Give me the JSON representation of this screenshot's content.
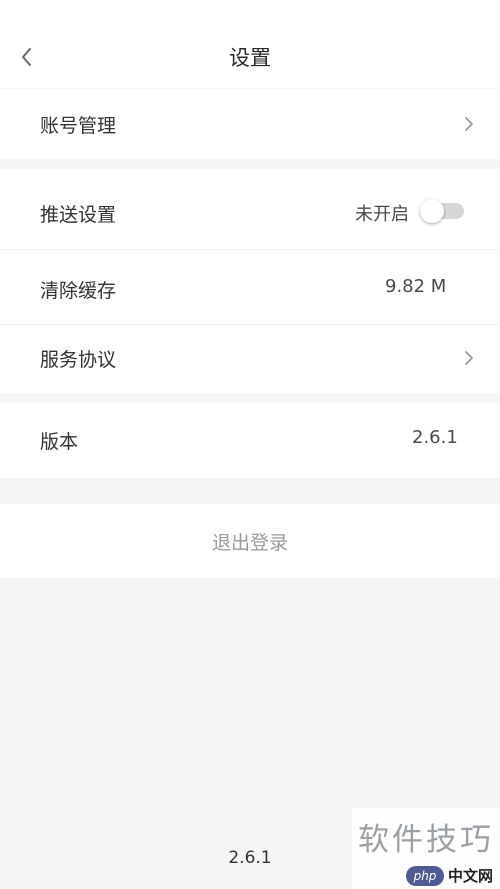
{
  "header": {
    "title": "设置"
  },
  "rows": {
    "account": {
      "label": "账号管理"
    },
    "push": {
      "label": "推送设置",
      "status": "未开启",
      "enabled": false
    },
    "cache": {
      "label": "清除缓存",
      "value": "9.82 M"
    },
    "service": {
      "label": "服务协议"
    },
    "version": {
      "label": "版本",
      "value": "2.6.1"
    }
  },
  "logout": {
    "label": "退出登录"
  },
  "footer": {
    "version": "2.6.1"
  },
  "watermark": {
    "title": "软件技巧",
    "badge_php": "php",
    "badge_site": "中文网"
  },
  "colors": {
    "background": "#f5f5f5",
    "card": "#ffffff",
    "logout_text": "#9a9a9a",
    "toggle_off": "#d6d6d6"
  },
  "icons": {
    "back": "chevron-left-icon",
    "row_arrow": "chevron-right-icon"
  }
}
